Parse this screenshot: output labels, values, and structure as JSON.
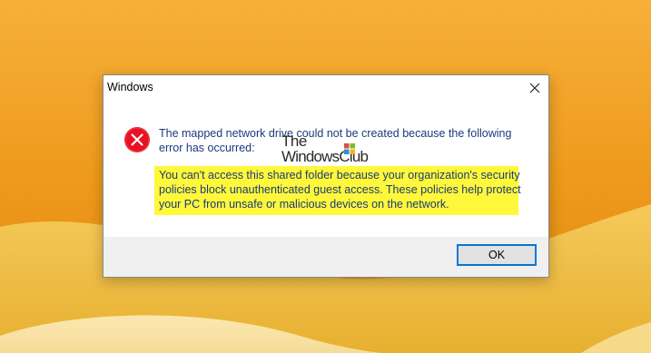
{
  "dialog": {
    "title": "Windows",
    "close_icon": "close-icon",
    "error_icon": "error-icon",
    "message": "The mapped network drive could not be created because the following error has occurred:",
    "detail": "You can't access this shared folder because your organization's security policies block unauthenticated guest access. These policies help protect your PC from unsafe or malicious devices on the network.",
    "ok_label": "OK"
  },
  "watermark": {
    "line1": "The",
    "line2": "WindowsClub"
  },
  "colors": {
    "error_red": "#e81123",
    "highlight_yellow": "#fff83a",
    "accent_blue": "#0078d7",
    "message_text": "#1a3a7a"
  }
}
